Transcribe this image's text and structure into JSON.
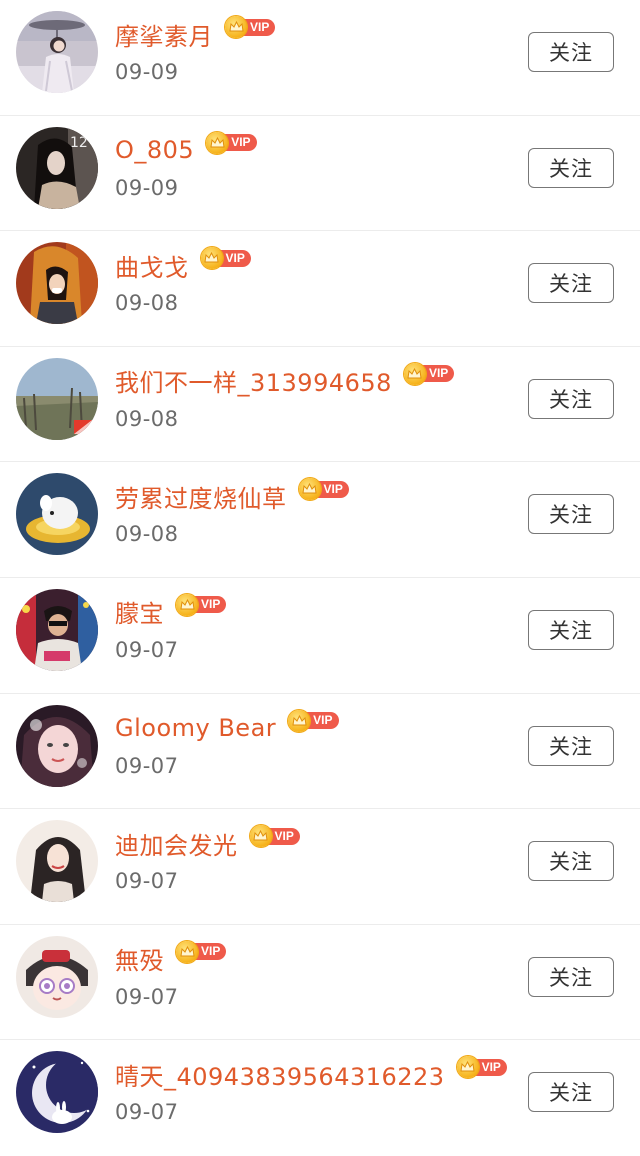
{
  "follow_label": "关注",
  "vip_label": "VIP",
  "colors": {
    "name": "#e05a2b",
    "vip_tag": "#ef5a4a",
    "crown": "#f6b21a",
    "date": "#6b6b6b",
    "divider": "#ececec"
  },
  "users": [
    {
      "name": "摩挲素月",
      "date": "09-09"
    },
    {
      "name": "O_805",
      "date": "09-09"
    },
    {
      "name": "曲戈戈",
      "date": "09-08"
    },
    {
      "name": "我们不一样_313994658",
      "date": "09-08"
    },
    {
      "name": "劳累过度烧仙草",
      "date": "09-08"
    },
    {
      "name": "朦宝",
      "date": "09-07"
    },
    {
      "name": "Gloomy Bear",
      "date": "09-07"
    },
    {
      "name": "迪加会发光",
      "date": "09-07"
    },
    {
      "name": "無殁",
      "date": "09-07"
    },
    {
      "name": "晴天_40943839564316223",
      "date": "09-07"
    }
  ]
}
